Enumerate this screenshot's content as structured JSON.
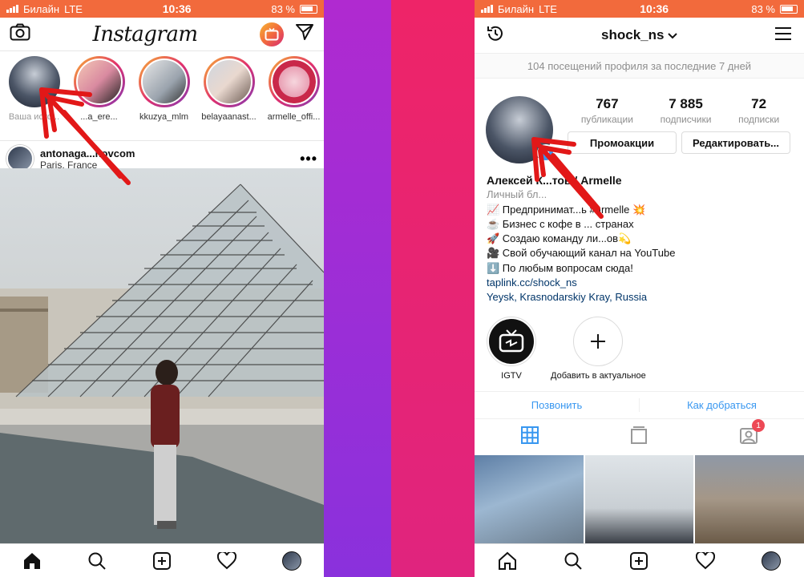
{
  "status_left": {
    "carrier": "Билайн",
    "network": "LTE",
    "time": "10:36",
    "battery": "83 %"
  },
  "status_right": {
    "carrier": "Билайн",
    "network": "LTE",
    "time": "10:36",
    "battery": "83 %"
  },
  "feed": {
    "logo": "Instagram",
    "stories": [
      {
        "label": "Ваша исто..."
      },
      {
        "label": "...a_ere..."
      },
      {
        "label": "kkuzya_mlm"
      },
      {
        "label": "belayaanast..."
      },
      {
        "label": "armelle_offi..."
      }
    ],
    "post": {
      "username": "antonaga...novcom",
      "location": "Paris, France",
      "more": "•••"
    }
  },
  "profile": {
    "username": "shock_ns",
    "visits": "104 посещений профиля за последние 7 дней",
    "stats": [
      {
        "num": "767",
        "label": "публикации"
      },
      {
        "num": "7 885",
        "label": "подписчики"
      },
      {
        "num": "72",
        "label": "подписки"
      }
    ],
    "buttons": {
      "promo": "Промоакции",
      "edit": "Редактировать..."
    },
    "bio": {
      "name": "Алексей К...тов / Armelle",
      "category": "Личный бл...",
      "line1": "📈 Предпринимат...ь #armelle 💥",
      "line2": "☕ Бизнес с кофе в ... странах",
      "line3": "🚀 Создаю команду ли...ов💫",
      "line4": "🎥 Свой обучающий канал на YouTube",
      "line5": "⬇️ По любым вопросам сюда!",
      "link": "taplink.cc/shock_ns",
      "location": "Yeysk, Krasnodarskiy Kray, Russia"
    },
    "highlights": [
      {
        "label": "IGTV"
      },
      {
        "label": "Добавить в актуальное"
      }
    ],
    "contact": {
      "call": "Позвонить",
      "directions": "Как добраться"
    },
    "tag_badge": "1"
  }
}
